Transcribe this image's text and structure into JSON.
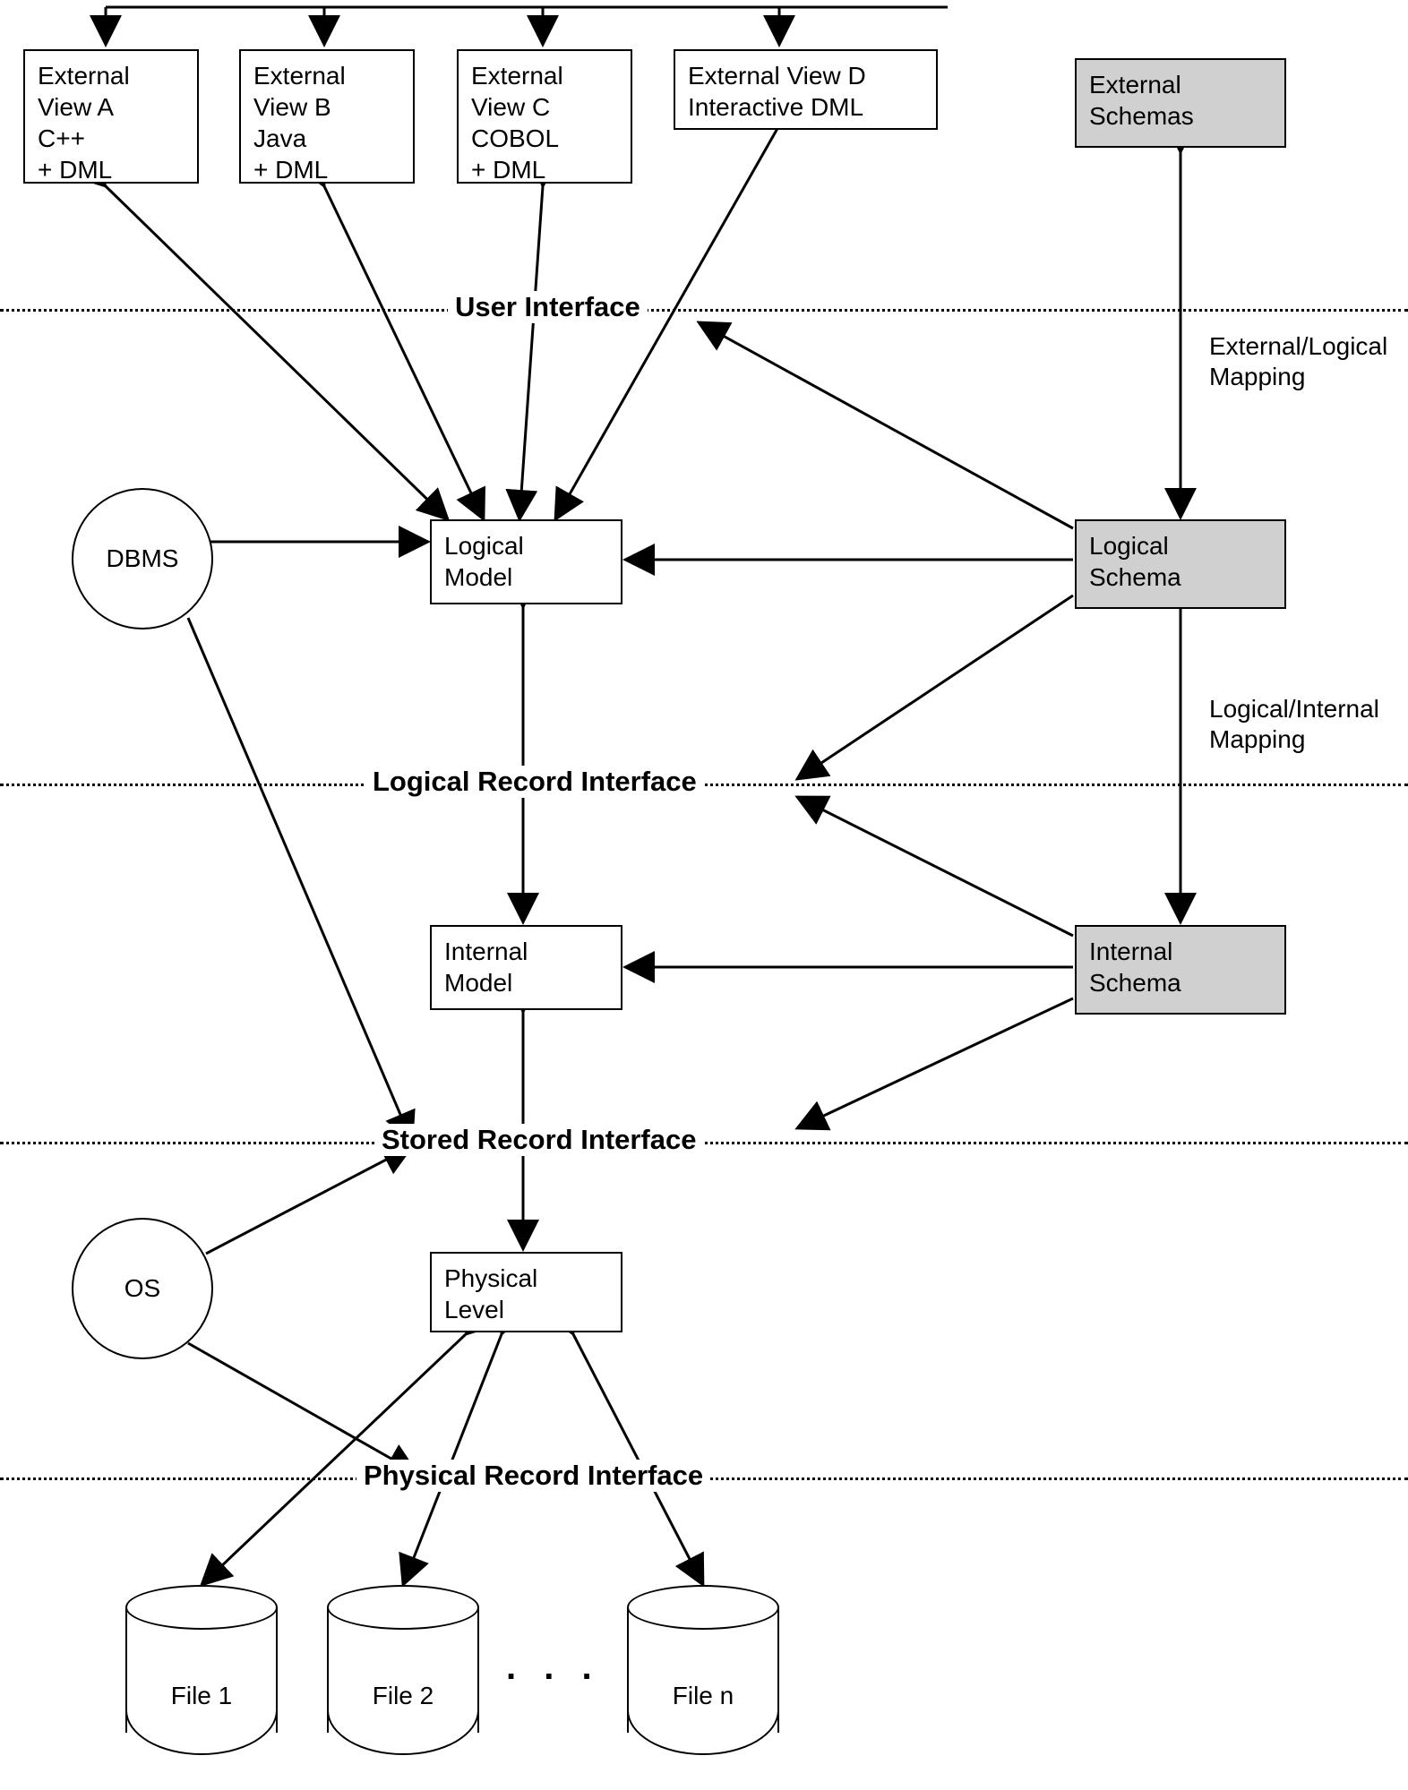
{
  "views": {
    "a": "External\nView A\nC++\n+ DML",
    "b": "External\nView B\nJava\n+ DML",
    "c": "External\nView C\nCOBOL\n+ DML",
    "d": "External View D\nInteractive DML"
  },
  "schemas": {
    "external": "External\nSchemas",
    "logical": "Logical\nSchema",
    "internal": "Internal\nSchema"
  },
  "models": {
    "logical": "Logical\nModel",
    "internal": "Internal\nModel",
    "physical": "Physical\nLevel"
  },
  "circles": {
    "dbms": "DBMS",
    "os": "OS"
  },
  "mappings": {
    "ext_log": "External/Logical\nMapping",
    "log_int": "Logical/Internal\nMapping"
  },
  "bands": {
    "user": "User Interface",
    "logical": "Logical Record Interface",
    "stored": "Stored Record Interface",
    "physical": "Physical Record Interface"
  },
  "files": {
    "f1": "File 1",
    "f2": "File 2",
    "fn": "File n",
    "ellipsis": ". . ."
  }
}
